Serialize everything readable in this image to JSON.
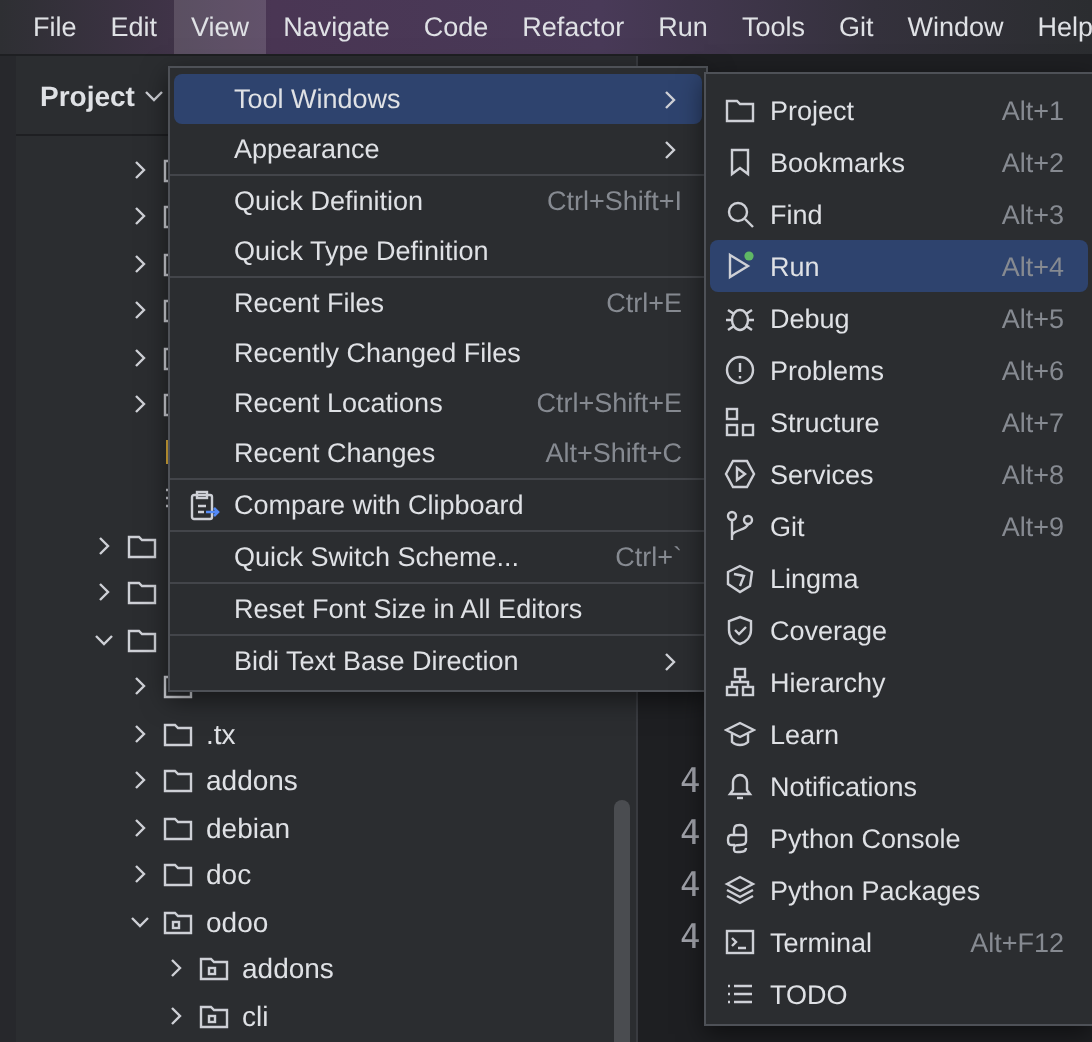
{
  "menubar": [
    {
      "label": "File",
      "selected": false
    },
    {
      "label": "Edit",
      "selected": false
    },
    {
      "label": "View",
      "selected": true
    },
    {
      "label": "Navigate",
      "selected": false
    },
    {
      "label": "Code",
      "selected": false
    },
    {
      "label": "Refactor",
      "selected": false
    },
    {
      "label": "Run",
      "selected": false
    },
    {
      "label": "Tools",
      "selected": false
    },
    {
      "label": "Git",
      "selected": false
    },
    {
      "label": "Window",
      "selected": false
    },
    {
      "label": "Help",
      "selected": false
    }
  ],
  "project_panel": {
    "title": "Project",
    "tree": {
      "continued": [
        {
          "kind": "folder",
          "expanded": false
        },
        {
          "kind": "folder",
          "expanded": false
        },
        {
          "kind": "folder",
          "expanded": false
        },
        {
          "kind": "folder",
          "expanded": false
        },
        {
          "kind": "folder",
          "expanded": false
        },
        {
          "kind": "folder",
          "expanded": false
        },
        {
          "kind": "file"
        },
        {
          "kind": "list"
        }
      ],
      "items": [
        {
          "kind": "folder",
          "expanded": false
        },
        {
          "kind": "folder",
          "expanded": false
        },
        {
          "kind": "folder",
          "expanded": true,
          "children": [
            {
              "kind": "folder",
              "expanded": false
            },
            {
              "kind": "folder",
              "label": ".tx",
              "expanded": false
            },
            {
              "kind": "folder",
              "label": "addons",
              "expanded": false
            },
            {
              "kind": "folder",
              "label": "debian",
              "expanded": false
            },
            {
              "kind": "folder",
              "label": "doc",
              "expanded": false
            },
            {
              "kind": "package",
              "label": "odoo",
              "expanded": true,
              "children": [
                {
                  "kind": "package",
                  "label": "addons",
                  "expanded": false
                },
                {
                  "kind": "package",
                  "label": "cli",
                  "expanded": false
                }
              ]
            }
          ]
        }
      ]
    }
  },
  "editor": {
    "line_numbers": [
      "4",
      "4",
      "4",
      "4"
    ]
  },
  "view_menu": {
    "items": [
      {
        "kind": "submenu",
        "label": "Tool Windows",
        "selected": true
      },
      {
        "kind": "submenu",
        "label": "Appearance",
        "selected": false
      },
      {
        "kind": "separator"
      },
      {
        "kind": "item",
        "label": "Quick Definition",
        "shortcut": "Ctrl+Shift+I",
        "selected": false
      },
      {
        "kind": "item",
        "label": "Quick Type Definition",
        "selected": false
      },
      {
        "kind": "separator"
      },
      {
        "kind": "item",
        "label": "Recent Files",
        "shortcut": "Ctrl+E",
        "selected": false
      },
      {
        "kind": "item",
        "label": "Recently Changed Files",
        "selected": false
      },
      {
        "kind": "item",
        "label": "Recent Locations",
        "shortcut": "Ctrl+Shift+E",
        "selected": false
      },
      {
        "kind": "item",
        "label": "Recent Changes",
        "shortcut": "Alt+Shift+C",
        "selected": false
      },
      {
        "kind": "separator"
      },
      {
        "kind": "icon-item",
        "label": "Compare with Clipboard",
        "selected": false
      },
      {
        "kind": "separator"
      },
      {
        "kind": "item",
        "label": "Quick Switch Scheme...",
        "shortcut": "Ctrl+`",
        "selected": false
      },
      {
        "kind": "separator"
      },
      {
        "kind": "item",
        "label": "Reset Font Size in All Editors",
        "selected": false
      },
      {
        "kind": "separator"
      },
      {
        "kind": "submenu",
        "label": "Bidi Text Base Direction",
        "selected": false
      }
    ]
  },
  "tool_windows_menu": {
    "items": [
      {
        "label": "Project",
        "shortcut": "Alt+1",
        "selected": false
      },
      {
        "label": "Bookmarks",
        "shortcut": "Alt+2",
        "selected": false
      },
      {
        "label": "Find",
        "shortcut": "Alt+3",
        "selected": false
      },
      {
        "label": "Run",
        "shortcut": "Alt+4",
        "selected": true
      },
      {
        "label": "Debug",
        "shortcut": "Alt+5",
        "selected": false
      },
      {
        "label": "Problems",
        "shortcut": "Alt+6",
        "selected": false
      },
      {
        "label": "Structure",
        "shortcut": "Alt+7",
        "selected": false
      },
      {
        "label": "Services",
        "shortcut": "Alt+8",
        "selected": false
      },
      {
        "label": "Git",
        "shortcut": "Alt+9",
        "selected": false
      },
      {
        "label": "Lingma",
        "selected": false
      },
      {
        "label": "Coverage",
        "selected": false
      },
      {
        "label": "Hierarchy",
        "selected": false
      },
      {
        "label": "Learn",
        "selected": false
      },
      {
        "label": "Notifications",
        "selected": false
      },
      {
        "label": "Python Console",
        "selected": false
      },
      {
        "label": "Python Packages",
        "selected": false
      },
      {
        "label": "Terminal",
        "shortcut": "Alt+F12",
        "selected": false
      },
      {
        "label": "TODO",
        "selected": false
      }
    ]
  }
}
